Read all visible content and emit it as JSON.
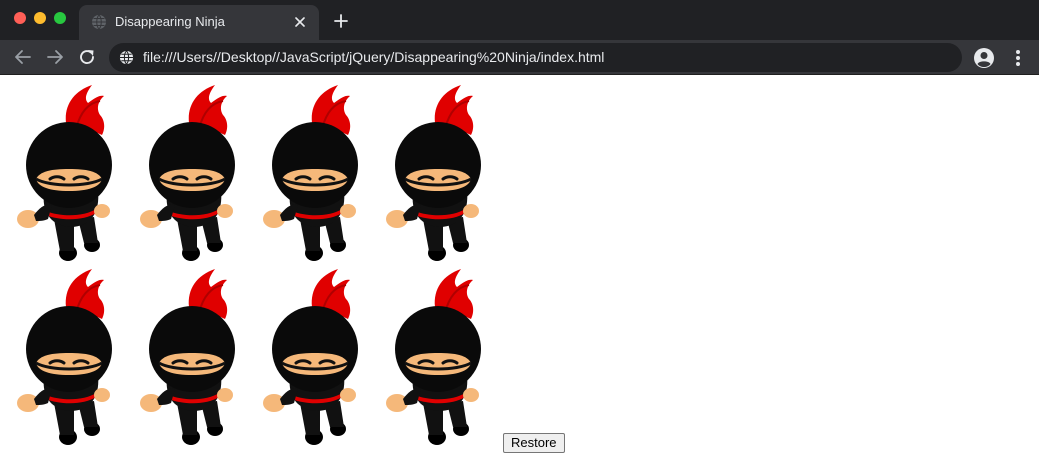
{
  "browser": {
    "tab": {
      "title": "Disappearing Ninja",
      "favicon": "globe-icon"
    },
    "address_bar": {
      "url": "file:///Users//Desktop//JavaScript/jQuery/Disappearing%20Ninja/index.html",
      "security_icon": "globe-icon"
    },
    "colors": {
      "frame": "#202124",
      "toolbar": "#35363a",
      "text": "#e8eaed"
    }
  },
  "page": {
    "ninjas": {
      "count": 8,
      "rows": 2,
      "per_row": 4,
      "image": "ninja-image"
    },
    "restore_button": {
      "label": "Restore"
    }
  }
}
